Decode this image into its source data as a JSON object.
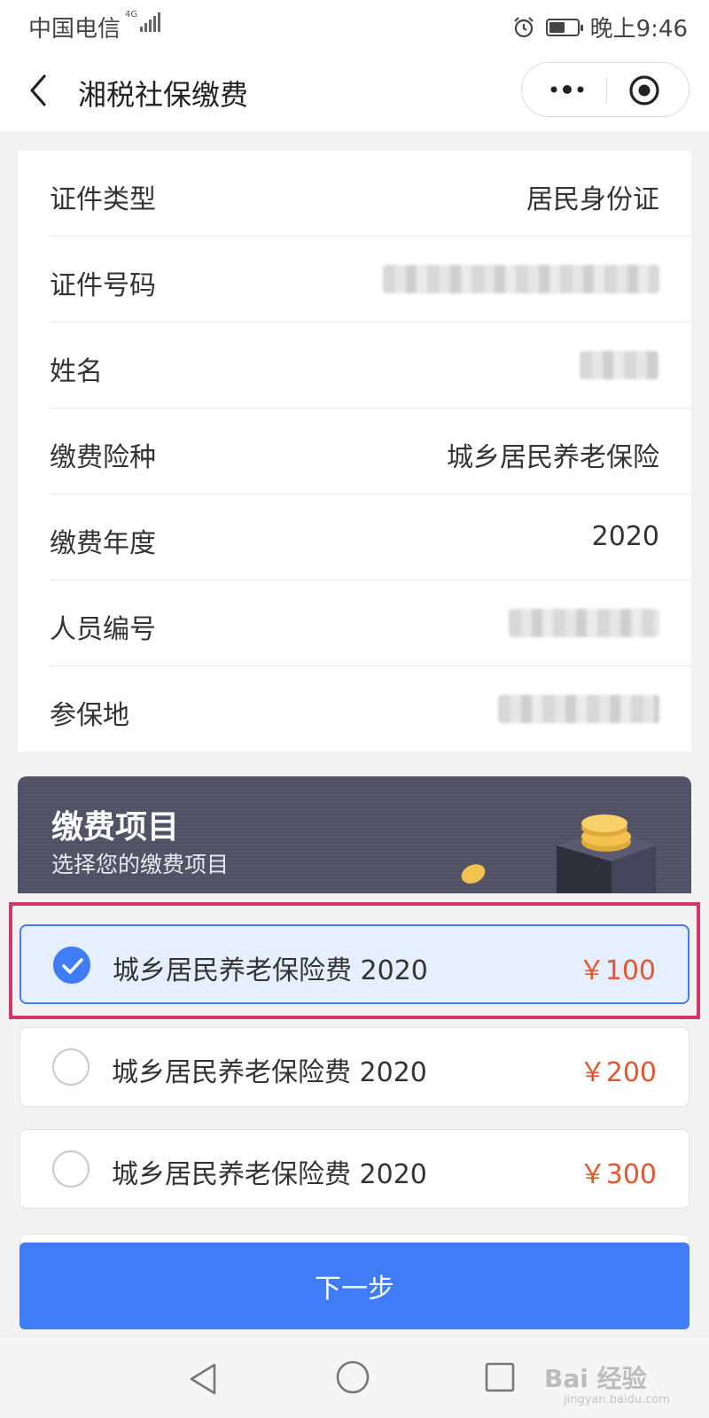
{
  "status_bar": {
    "carrier": "中国电信",
    "network": "4G",
    "time": "晚上9:46",
    "battery_level": 0.55
  },
  "nav": {
    "title": "湘税社保缴费"
  },
  "info": {
    "rows": [
      {
        "label": "证件类型",
        "value": "居民身份证"
      },
      {
        "label": "证件号码",
        "value": null
      },
      {
        "label": "姓名",
        "value": null
      },
      {
        "label": "缴费险种",
        "value": "城乡居民养老保险"
      },
      {
        "label": "缴费年度",
        "value": "2020"
      },
      {
        "label": "人员编号",
        "value": null
      },
      {
        "label": "参保地",
        "value": null
      }
    ]
  },
  "banner": {
    "title": "缴费项目",
    "subtitle": "选择您的缴费项目"
  },
  "items": [
    {
      "name": "城乡居民养老保险费 2020",
      "price": "￥100",
      "selected": true
    },
    {
      "name": "城乡居民养老保险费 2020",
      "price": "￥200",
      "selected": false
    },
    {
      "name": "城乡居民养老保险费 2020",
      "price": "￥300",
      "selected": false
    }
  ],
  "next_button": {
    "label": "下一步"
  },
  "watermark": {
    "text": "Bai 经验",
    "sub": "jingyan.baidu.com"
  },
  "colors": {
    "accent": "#3f7cf6",
    "price": "#e4572e",
    "highlight": "#d0356d"
  }
}
